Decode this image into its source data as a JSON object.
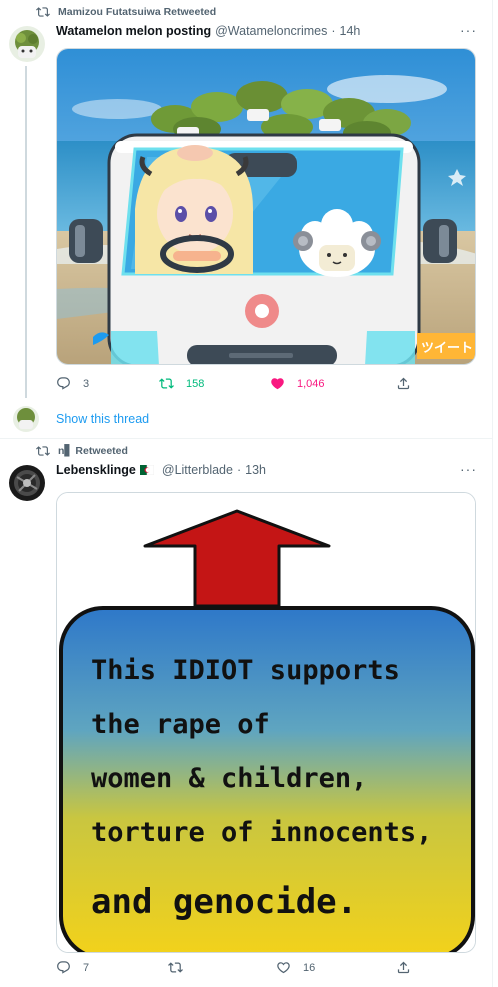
{
  "tweet1": {
    "retweeted_by": "Mamizou Futatsuiwa Retweeted",
    "display_name": "Watamelon melon posting",
    "handle": "@Watameloncrimes",
    "time": "14h",
    "more": "···",
    "image_overlay_text": "ツイート",
    "replies": "3",
    "retweets": "158",
    "likes": "1,046",
    "show_thread": "Show this thread"
  },
  "tweet2": {
    "retweeted_by": "n▋ Retweeted",
    "display_name": "Lebensklinge",
    "handle": "@Litterblade",
    "time": "13h",
    "more": "···",
    "image_text_lines": [
      "This IDIOT supports",
      "the rape of",
      "women & children,",
      "torture of innocents,",
      "and genocide."
    ],
    "replies": "7",
    "retweets": "",
    "likes": "16"
  },
  "colors": {
    "retweet_green": "#00ba7c",
    "like_pink": "#f91880",
    "link_blue": "#1d9bf0",
    "muted": "#536471"
  }
}
